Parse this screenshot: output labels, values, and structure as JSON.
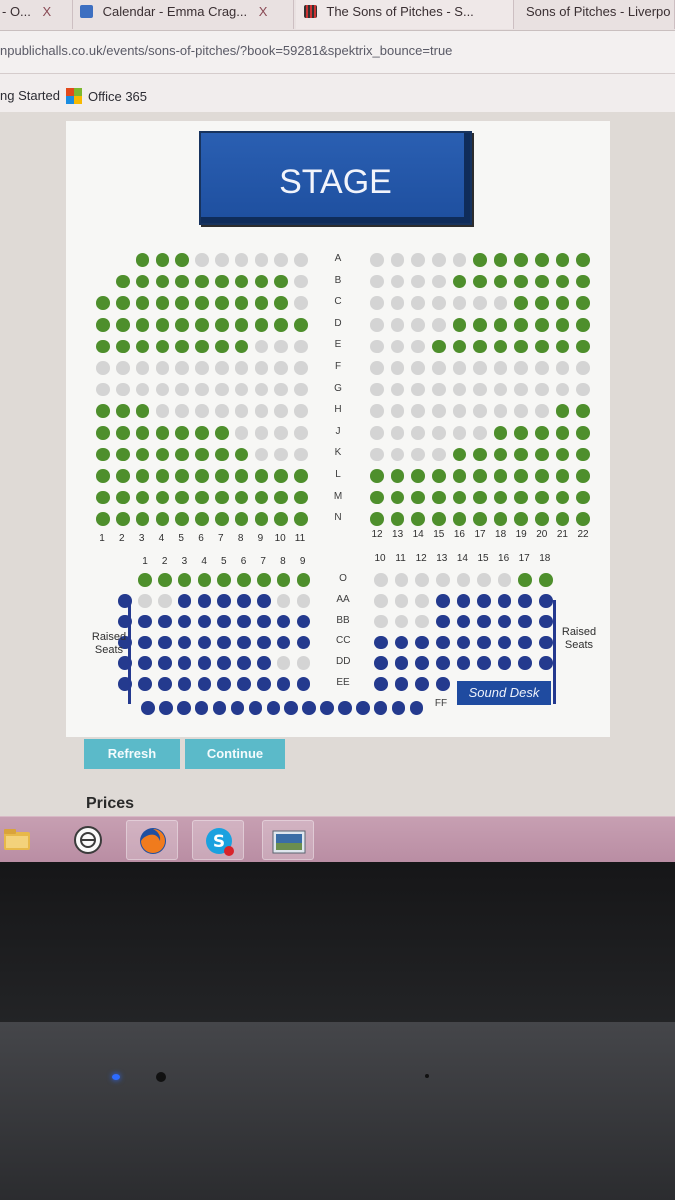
{
  "browser": {
    "tabs": [
      {
        "label": "- O...",
        "close": "X"
      },
      {
        "label": "Calendar - Emma Crag...",
        "close": "X"
      },
      {
        "label": "The Sons of Pitches - S...",
        "close": ""
      },
      {
        "label": "Sons of Pitches - Liverpo",
        "close": ""
      }
    ],
    "url": "npublichalls.co.uk/events/sons-of-pitches/?book=59281&spektrix_bounce=true",
    "bookmarks": [
      "ng Started",
      "Office 365"
    ]
  },
  "seatmap": {
    "stage_label": "STAGE",
    "row_labels_upper": [
      "A",
      "B",
      "C",
      "D",
      "E",
      "F",
      "G",
      "H",
      "J",
      "K",
      "L",
      "M",
      "N"
    ],
    "row_labels_lower": [
      "O",
      "AA",
      "BB",
      "CC",
      "DD",
      "EE",
      "FF"
    ],
    "left_numbers": [
      "1",
      "2",
      "3",
      "4",
      "5",
      "6",
      "7",
      "8",
      "9",
      "10",
      "11"
    ],
    "right_numbers": [
      "12",
      "13",
      "14",
      "15",
      "16",
      "17",
      "18",
      "19",
      "20",
      "21",
      "22"
    ],
    "lower_left_numbers": [
      "1",
      "2",
      "3",
      "4",
      "5",
      "6",
      "7",
      "8",
      "9"
    ],
    "lower_right_numbers": [
      "10",
      "11",
      "12",
      "13",
      "14",
      "15",
      "16",
      "17",
      "18"
    ],
    "raised_left": "Raised Seats",
    "raised_right": "Raised Seats",
    "sound_desk": "Sound Desk",
    "colors": {
      "available": "#4e8f2c",
      "unavailable": "#d4d4d4",
      "raised": "#243a8e"
    }
  },
  "actions": {
    "refresh_label": "Refresh",
    "continue_label": "Continue"
  },
  "prices_heading": "Prices",
  "taskbar": {
    "icons": [
      "folder-icon",
      "circle-app-icon",
      "firefox-icon",
      "skype-icon",
      "photo-viewer-icon"
    ]
  }
}
